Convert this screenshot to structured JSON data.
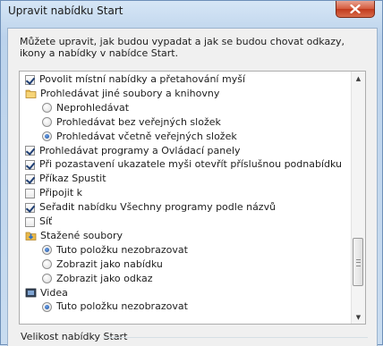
{
  "window": {
    "title": "Upravit nabídku Start"
  },
  "description": "Můžete upravit, jak budou vypadat a jak se budou chovat odkazy, ikony a nabídky v nabídce Start.",
  "items": [
    {
      "type": "checkbox",
      "checked": true,
      "indent": 0,
      "label": "Povolit místní nabídky a přetahování myší"
    },
    {
      "type": "group",
      "icon": "folder-icon",
      "indent": 0,
      "label": "Prohledávat jiné soubory a knihovny"
    },
    {
      "type": "radio",
      "checked": false,
      "indent": 1,
      "label": "Neprohledávat"
    },
    {
      "type": "radio",
      "checked": false,
      "indent": 1,
      "label": "Prohledávat bez veřejných složek"
    },
    {
      "type": "radio",
      "checked": true,
      "indent": 1,
      "label": "Prohledávat včetně veřejných složek"
    },
    {
      "type": "checkbox",
      "checked": true,
      "indent": 0,
      "label": "Prohledávat programy a Ovládací panely"
    },
    {
      "type": "checkbox",
      "checked": true,
      "indent": 0,
      "label": "Při pozastavení ukazatele myši otevřít příslušnou podnabídku"
    },
    {
      "type": "checkbox",
      "checked": true,
      "indent": 0,
      "label": "Příkaz Spustit"
    },
    {
      "type": "checkbox",
      "checked": false,
      "indent": 0,
      "label": "Připojit k"
    },
    {
      "type": "checkbox",
      "checked": true,
      "indent": 0,
      "label": "Seřadit nabídku Všechny programy podle názvů"
    },
    {
      "type": "checkbox",
      "checked": false,
      "indent": 0,
      "label": "Síť"
    },
    {
      "type": "group",
      "icon": "downloads-folder-icon",
      "indent": 0,
      "label": "Stažené soubory"
    },
    {
      "type": "radio",
      "checked": true,
      "indent": 1,
      "label": "Tuto položku nezobrazovat"
    },
    {
      "type": "radio",
      "checked": false,
      "indent": 1,
      "label": "Zobrazit jako nabídku"
    },
    {
      "type": "radio",
      "checked": false,
      "indent": 1,
      "label": "Zobrazit jako odkaz"
    },
    {
      "type": "group",
      "icon": "videos-icon",
      "indent": 0,
      "label": "Videa"
    },
    {
      "type": "radio",
      "checked": true,
      "indent": 1,
      "label": "Tuto položku nezobrazovat"
    }
  ],
  "scroll_position": 0.62,
  "group_box": {
    "label": "Velikost nabídky Start"
  },
  "colors": {
    "accent": "#1c4e9c",
    "close_button": "#c13a1d"
  }
}
